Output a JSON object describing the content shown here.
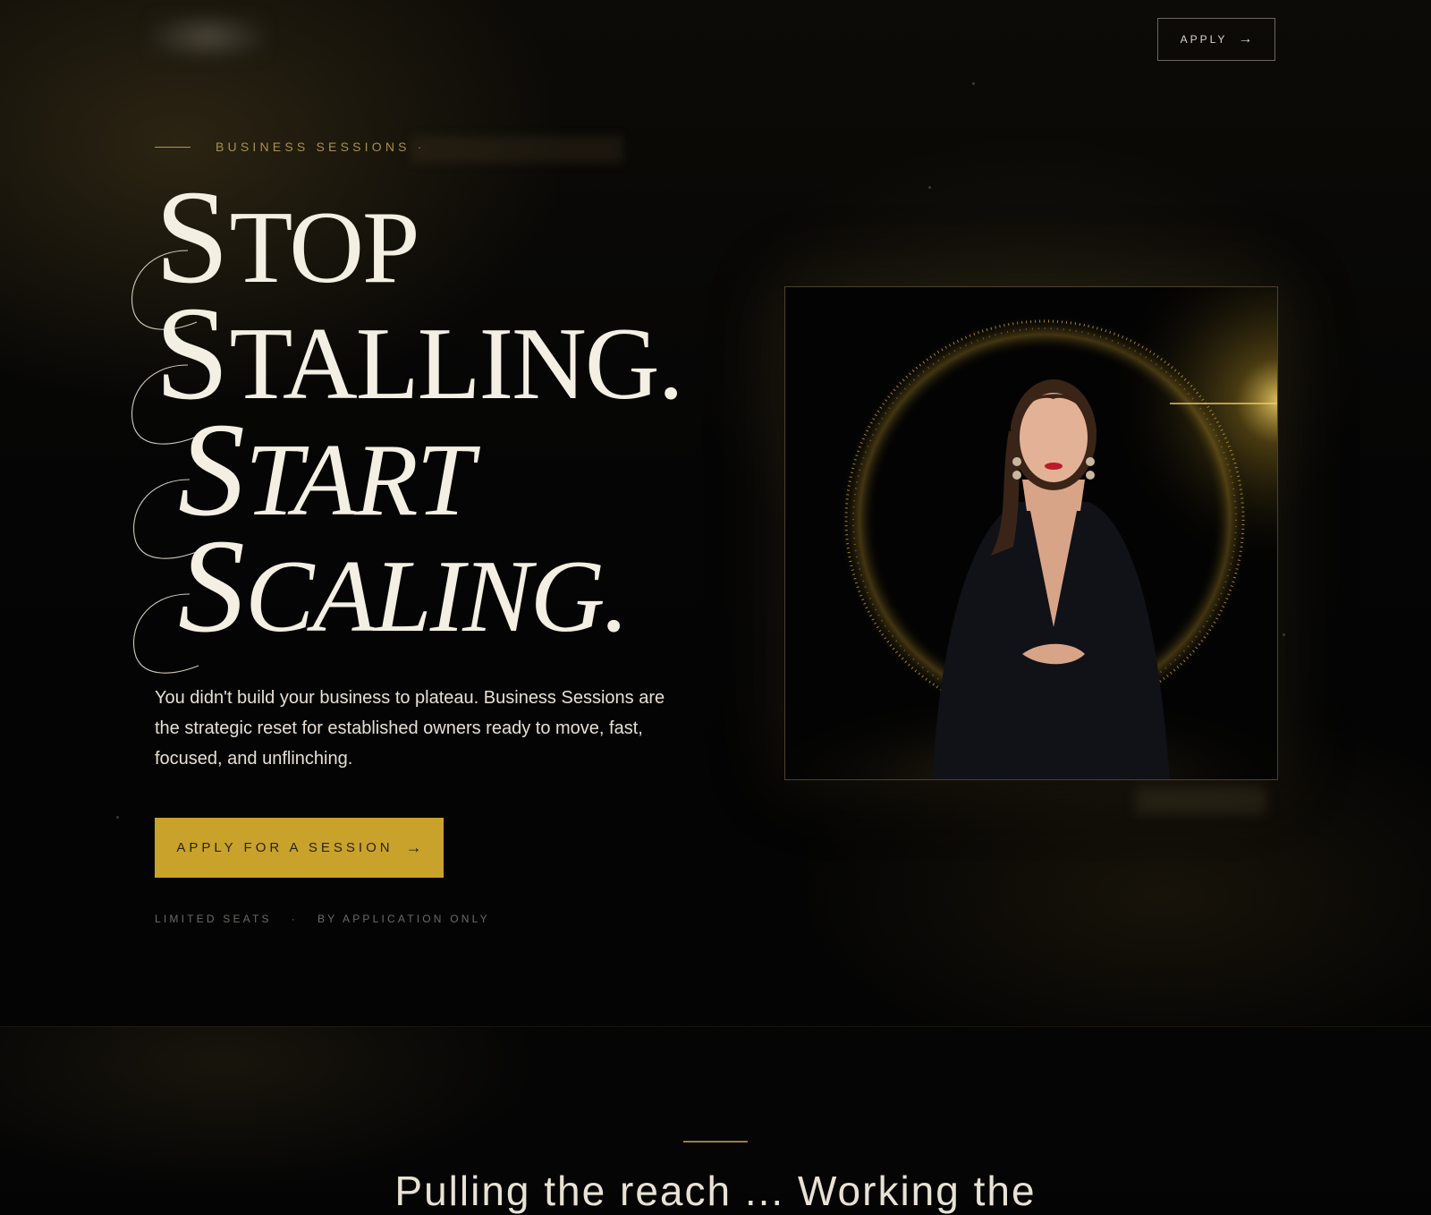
{
  "nav": {
    "apply_label": "APPLY",
    "apply_arrow": "→"
  },
  "hero": {
    "eyebrow": "BUSINESS SESSIONS ·",
    "headline": [
      {
        "cap": "S",
        "rest": "TOP"
      },
      {
        "cap": "S",
        "rest": "TALLING."
      },
      {
        "cap": "S",
        "rest": "TART"
      },
      {
        "cap": "S",
        "rest": "CALING."
      }
    ],
    "lede": "You didn't build your business to plateau. Business Sessions are the strategic reset for established owners ready to move, fast, focused, and unflinching.",
    "cta_label": "APPLY FOR A SESSION",
    "cta_arrow": "→",
    "fine_left": "LIMITED SEATS",
    "fine_sep": "·",
    "fine_right": "BY APPLICATION ONLY"
  },
  "section2": {
    "heading_partial": "Pulling the reach ... Working the"
  },
  "colors": {
    "accent_gold": "#c9a22b",
    "background": "#040404",
    "text_light": "#f4efe3"
  },
  "icons": {
    "nav_arrow": "arrow-right-icon",
    "cta_arrow": "arrow-right-icon"
  }
}
